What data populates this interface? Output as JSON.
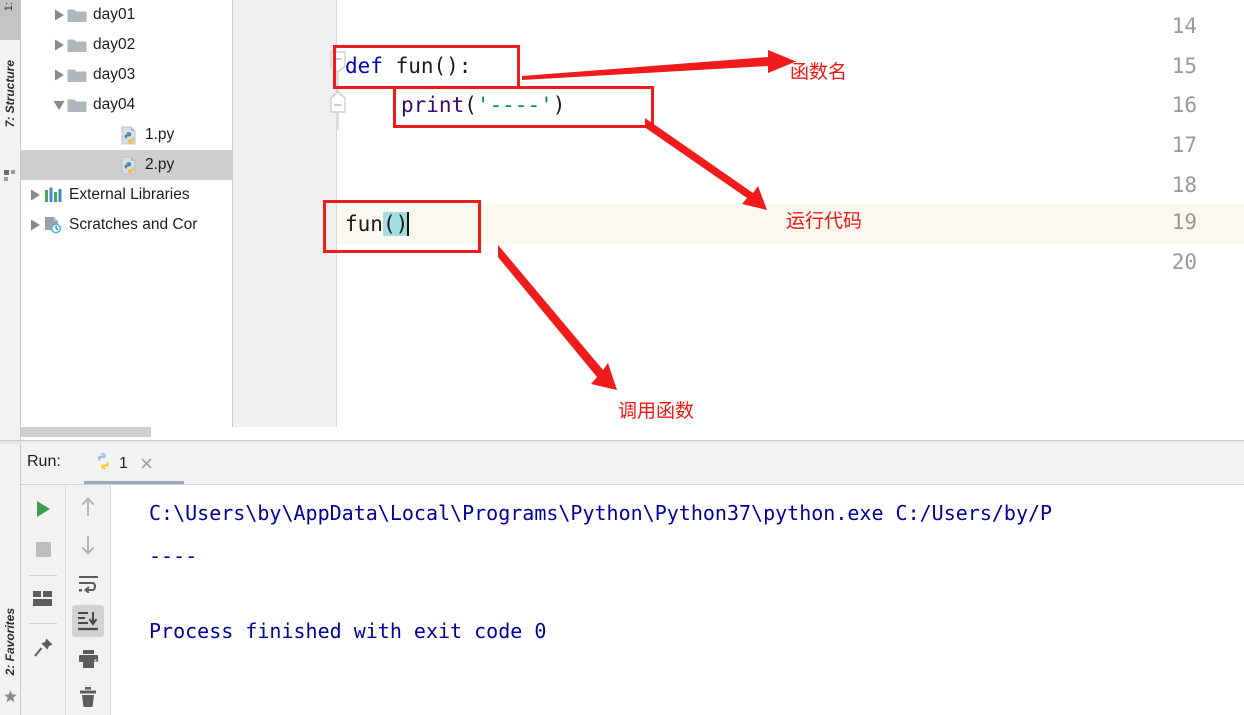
{
  "left_strip": {
    "project_label": "1:",
    "structure_label": "7: Structure",
    "favorites_label": "2: Favorites"
  },
  "project_tree": {
    "items": [
      {
        "label": "day01",
        "icon": "folder-icon",
        "arrow": "collapsed",
        "indent": 30,
        "selected": false
      },
      {
        "label": "day02",
        "icon": "folder-icon",
        "arrow": "collapsed",
        "indent": 30,
        "selected": false
      },
      {
        "label": "day03",
        "icon": "folder-icon",
        "arrow": "collapsed",
        "indent": 30,
        "selected": false
      },
      {
        "label": "day04",
        "icon": "folder-icon",
        "arrow": "expanded",
        "indent": 30,
        "selected": false
      },
      {
        "label": "1.py",
        "icon": "python-file-icon",
        "arrow": "none",
        "indent": 82,
        "selected": false
      },
      {
        "label": "2.py",
        "icon": "python-file-icon",
        "arrow": "none",
        "indent": 82,
        "selected": true
      },
      {
        "label": "External Libraries",
        "icon": "library-icon",
        "arrow": "collapsed",
        "indent": 6,
        "selected": false
      },
      {
        "label": "Scratches and Cor",
        "icon": "scratches-icon",
        "arrow": "collapsed",
        "indent": 6,
        "selected": false
      }
    ]
  },
  "editor": {
    "line_numbers": [
      "14",
      "15",
      "16",
      "17",
      "18",
      "19",
      "20"
    ],
    "highlighted_line": "19",
    "lines": {
      "l15_kw": "def",
      "l15_name": " fun():",
      "l16_builtin": "print",
      "l16_open": "(",
      "l16_str": "'----'",
      "l16_close": ")",
      "l19_name": "fun",
      "l19_parens": "()"
    },
    "colors": {
      "keyword": "#0000c0",
      "string": "#008080",
      "builtin": "#3a0b6b",
      "plain": "#1a1a1a",
      "line_highlight": "#fbf8ef",
      "paren_match": "#a5dede"
    }
  },
  "annotations": {
    "accent_color": "#f51515",
    "items": [
      {
        "text": "函数名"
      },
      {
        "text": "运行代码"
      },
      {
        "text": "调用函数"
      }
    ]
  },
  "run_panel": {
    "title": "Run:",
    "tab_label": "1",
    "tab_icon": "python-icon",
    "close_icon": "close-icon",
    "toolbar_left": [
      {
        "name": "rerun-button",
        "icon": "play-icon"
      },
      {
        "name": "stop-button",
        "icon": "stop-icon"
      },
      {
        "name": "layout-button",
        "icon": "layout-icon"
      },
      {
        "name": "pin-button",
        "icon": "pin-icon"
      }
    ],
    "toolbar_right": [
      {
        "name": "up-button",
        "icon": "arrow-up-icon"
      },
      {
        "name": "down-button",
        "icon": "arrow-down-icon"
      },
      {
        "name": "soft-wrap-button",
        "icon": "soft-wrap-icon"
      },
      {
        "name": "scroll-to-end-button",
        "icon": "scroll-end-icon"
      },
      {
        "name": "print-button",
        "icon": "printer-icon"
      },
      {
        "name": "clear-button",
        "icon": "trash-icon"
      }
    ],
    "console": {
      "line1": "C:\\Users\\by\\AppData\\Local\\Programs\\Python\\Python37\\python.exe C:/Users/by/P",
      "line2": "----",
      "line3": "Process finished with exit code 0"
    }
  }
}
